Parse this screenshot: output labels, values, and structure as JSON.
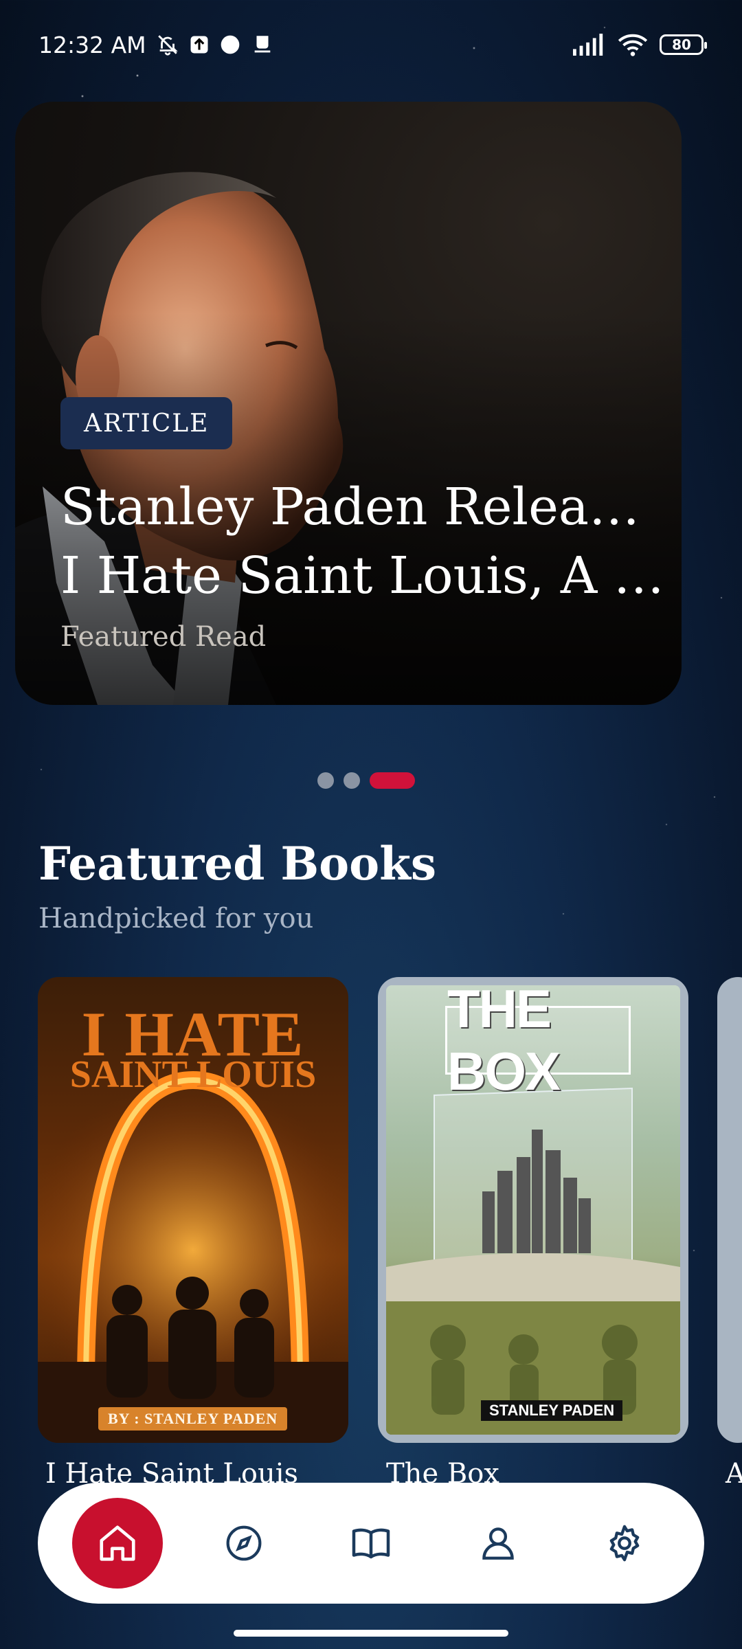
{
  "status_bar": {
    "time": "12:32 AM",
    "battery": "80",
    "icons": [
      "mute-icon",
      "upload-icon",
      "circle-icon",
      "notification-icon",
      "signal-icon",
      "wifi-icon",
      "battery-icon"
    ]
  },
  "hero": {
    "badge": "ARTICLE",
    "title_line1": "Stanley Paden Releases",
    "title_line2": "I Hate Saint Louis, A Pi...",
    "subtitle": "Featured Read",
    "active_slide": 3,
    "slide_count": 3
  },
  "featured": {
    "title": "Featured Books",
    "subtitle": "Handpicked for you",
    "books": [
      {
        "title": "I Hate Saint Louis",
        "cover_line1": "I HATE",
        "cover_line2": "SAINT LOUIS",
        "cover_author": "BY : STANLEY PADEN"
      },
      {
        "title": "The Box",
        "cover_line1": "THE BOX",
        "cover_author": "STANLEY PADEN"
      },
      {
        "title": "A"
      }
    ]
  },
  "nav": {
    "items": [
      "home-icon",
      "compass-icon",
      "book-icon",
      "user-icon",
      "gear-icon"
    ],
    "active": "home-icon",
    "accent": "#c8102e"
  },
  "colors": {
    "accent": "#d0123a",
    "badge_bg": "#1b2d50",
    "background": "#10294a"
  }
}
